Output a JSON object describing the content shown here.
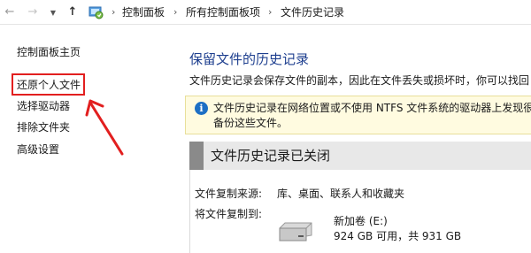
{
  "address_bar": {
    "crumbs": [
      "控制面板",
      "所有控制面板项",
      "文件历史记录"
    ],
    "separator": "›"
  },
  "left_nav": {
    "items": [
      "控制面板主页",
      "还原个人文件",
      "选择驱动器",
      "排除文件夹",
      "高级设置"
    ],
    "highlighted": "还原个人文件",
    "highlight_color": "#e21f1f"
  },
  "main": {
    "title": "保留文件的历史记录",
    "description": "文件历史记录会保存文件的副本，因此在文件丢失或损坏时，你可以找回",
    "info": {
      "line1": "文件历史记录在网络位置或不使用 NTFS 文件系统的驱动器上发现很",
      "line2": "备份这些文件。"
    },
    "status": "文件历史记录已关闭",
    "copy_from_label": "文件复制来源:",
    "copy_from_value": "库、桌面、联系人和收藏夹",
    "copy_to_label": "将文件复制到:",
    "drive": {
      "name": "新加卷 (E:)",
      "space": "924 GB 可用，共 931 GB"
    }
  },
  "colors": {
    "title": "#1e3f8f",
    "info_bg": "#fffbe0",
    "status_bg": "#e8e8e8"
  }
}
